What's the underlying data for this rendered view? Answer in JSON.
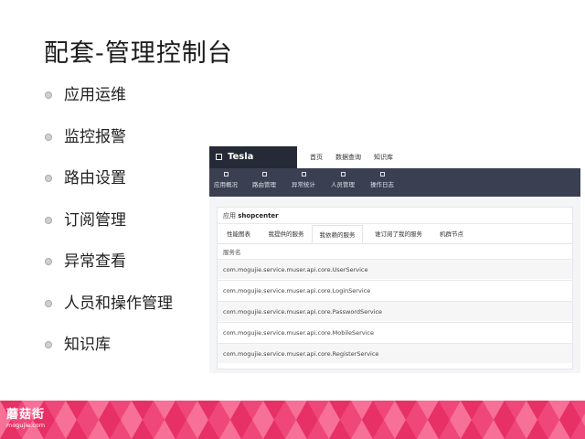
{
  "slide": {
    "title": "配套-管理控制台",
    "bullets": [
      "应用运维",
      "监控报警",
      "路由设置",
      "订阅管理",
      "异常查看",
      "人员和操作管理",
      "知识库"
    ]
  },
  "app": {
    "brand": "Tesla",
    "top_nav": [
      "首页",
      "数据查询",
      "知识库"
    ],
    "sub_nav": [
      "应用概况",
      "路由管理",
      "异常统计",
      "人员管理",
      "操作日志"
    ],
    "app_label": "应用",
    "app_name": "shopcenter",
    "tabs": [
      "性能图表",
      "我提供的服务",
      "我依赖的服务",
      "谁订阅了我的服务",
      "机群节点"
    ],
    "active_tab": "我依赖的服务",
    "column_header": "服务名",
    "services": [
      "com.mogujie.service.muser.api.core.UserService",
      "com.mogujie.service.muser.api.core.LoginService",
      "com.mogujie.service.muser.api.core.PasswordService",
      "com.mogujie.service.muser.api.core.MobileService",
      "com.mogujie.service.muser.api.core.RegisterService"
    ]
  },
  "footer": {
    "logo_text": "蘑菇街",
    "logo_url": "mogujie.com",
    "colors": {
      "pink": "#f0477a",
      "pink_light": "#f7749a",
      "pink_dark": "#e52d63"
    }
  }
}
